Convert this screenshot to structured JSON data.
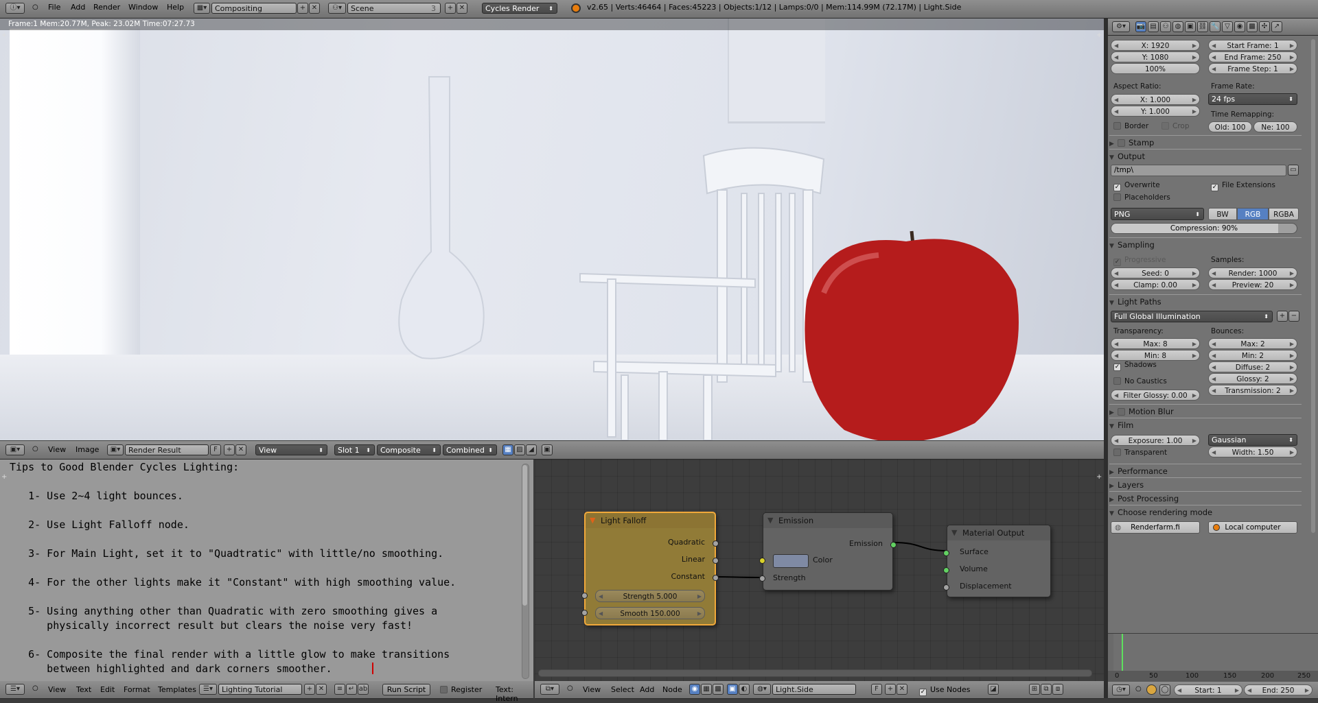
{
  "top_bar": {
    "menus": [
      "File",
      "Add",
      "Render",
      "Window",
      "Help"
    ],
    "screen_layout": "Compositing",
    "scene": "Scene",
    "scene_users": "3",
    "render_engine": "Cycles Render",
    "stats": "v2.65 | Verts:46464 | Faces:45223 | Objects:1/12 | Lamps:0/0 | Mem:114.99M (72.17M) | Light.Side"
  },
  "render_view": {
    "info": "Frame:1 Mem:20.77M, Peak: 23.02M Time:07:27.73"
  },
  "image_header": {
    "menus": [
      "View",
      "Image"
    ],
    "image": "Render Result",
    "fake_user": "F",
    "view": "View",
    "slot": "Slot 1",
    "layer": "Composite",
    "pass": "Combined"
  },
  "text_editor": {
    "lines": [
      "Tips to Good Blender Cycles Lighting:",
      "",
      "   1- Use 2~4 light bounces.",
      "",
      "   2- Use Light Falloff node.",
      "",
      "   3- For Main Light, set it to \"Quadtratic\" with little/no smoothing.",
      "",
      "   4- For the other lights make it \"Constant\" with high smoothing value.",
      "",
      "   5- Using anything other than Quadratic with zero smoothing gives a",
      "      physically incorrect result but clears the noise very fast!",
      "",
      "   6- Composite the final render with a little glow to make transitions",
      "      between highlighted and dark corners smoother."
    ]
  },
  "text_header": {
    "menus": [
      "View",
      "Text",
      "Edit",
      "Format",
      "Templates"
    ],
    "text_name": "Lighting Tutorial",
    "run_script": "Run Script",
    "register": "Register",
    "status": "Text: Intern"
  },
  "node_editor": {
    "nodes": {
      "falloff": {
        "title": "Light Falloff",
        "outputs": [
          "Quadratic",
          "Linear",
          "Constant"
        ],
        "strength": "Strength 5.000",
        "smooth": "Smooth 150.000"
      },
      "emission": {
        "title": "Emission",
        "output": "Emission",
        "color_label": "Color",
        "strength_label": "Strength"
      },
      "output": {
        "title": "Material Output",
        "inputs": [
          "Surface",
          "Volume",
          "Displacement"
        ]
      }
    }
  },
  "node_header": {
    "menus": [
      "View",
      "Select",
      "Add",
      "Node"
    ],
    "material": "Light.Side",
    "fake_user": "F",
    "use_nodes": "Use Nodes"
  },
  "properties": {
    "dimensions": {
      "res_x": "X: 1920",
      "res_y": "Y: 1080",
      "percent": "100%",
      "start_frame": "Start Frame: 1",
      "end_frame": "End Frame: 250",
      "frame_step": "Frame Step: 1",
      "aspect_label": "Aspect Ratio:",
      "aspect_x": "X: 1.000",
      "aspect_y": "Y: 1.000",
      "frame_rate_label": "Frame Rate:",
      "frame_rate": "24 fps",
      "remap_label": "Time Remapping:",
      "remap_old": "Old: 100",
      "remap_new": "Ne: 100",
      "border": "Border",
      "crop": "Crop"
    },
    "stamp": "Stamp",
    "output": {
      "title": "Output",
      "path": "/tmp\\",
      "overwrite": "Overwrite",
      "file_extensions": "File Extensions",
      "placeholders": "Placeholders",
      "format": "PNG",
      "color_modes": [
        "BW",
        "RGB",
        "RGBA"
      ],
      "compression": "Compression: 90%",
      "compression_value": 0.9
    },
    "sampling": {
      "title": "Sampling",
      "progressive": "Progressive",
      "samples_label": "Samples:",
      "seed": "Seed: 0",
      "clamp": "Clamp: 0.00",
      "render": "Render: 1000",
      "preview": "Preview: 20"
    },
    "light_paths": {
      "title": "Light Paths",
      "preset": "Full Global Illumination",
      "transparency_label": "Transparency:",
      "bounces_label": "Bounces:",
      "t_max": "Max: 8",
      "t_min": "Min: 8",
      "b_max": "Max: 2",
      "b_min": "Min: 2",
      "shadows": "Shadows",
      "no_caustics": "No Caustics",
      "filter_glossy": "Filter Glossy: 0.00",
      "diffuse": "Diffuse: 2",
      "glossy": "Glossy: 2",
      "transmission": "Transmission: 2"
    },
    "motion_blur": "Motion Blur",
    "film": {
      "title": "Film",
      "exposure": "Exposure: 1.00",
      "filter": "Gaussian",
      "transparent": "Transparent",
      "width": "Width: 1.50"
    },
    "performance": "Performance",
    "layers": "Layers",
    "post_processing": "Post Processing",
    "render_mode": {
      "title": "Choose rendering mode",
      "renderfarm": "Renderfarm.fi",
      "local": "Local computer"
    }
  },
  "timeline": {
    "ticks": [
      "0",
      "50",
      "100",
      "150",
      "200",
      "250"
    ],
    "start": "Start: 1",
    "end": "End: 250"
  }
}
